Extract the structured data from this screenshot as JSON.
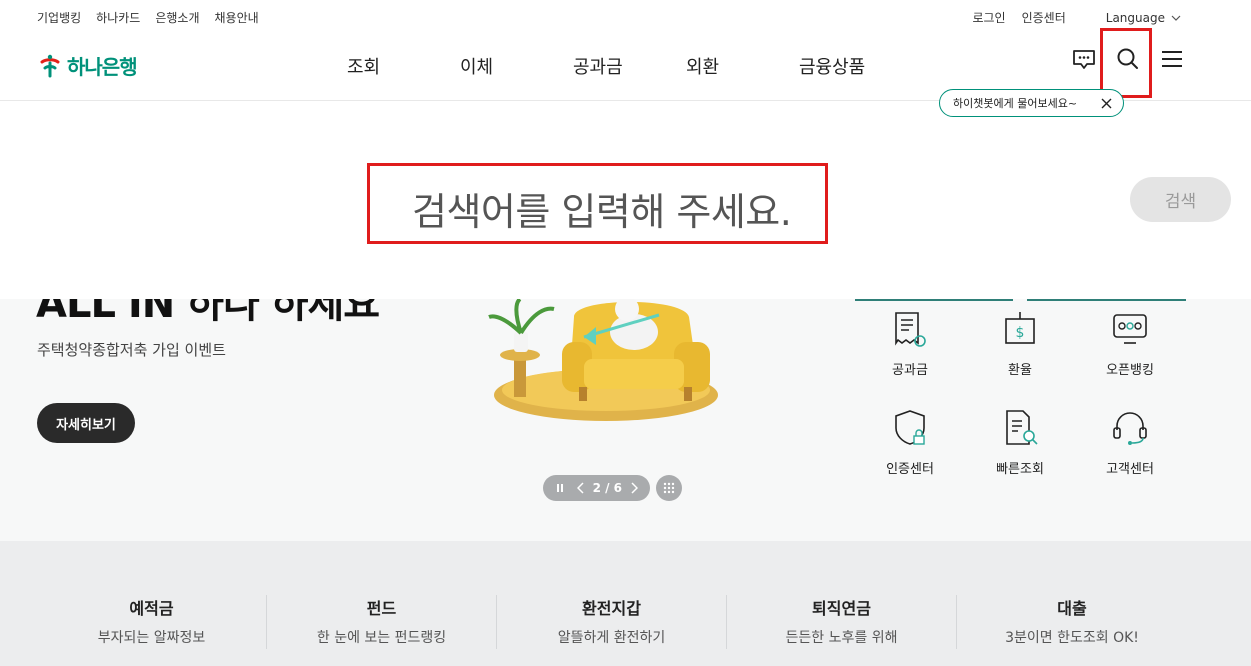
{
  "util": {
    "left": [
      "기업뱅킹",
      "하나카드",
      "은행소개",
      "채용안내"
    ],
    "login": "로그인",
    "cert_center": "인증센터",
    "language": "Language"
  },
  "logo": {
    "text": "하나은행"
  },
  "menu": [
    "조회",
    "이체",
    "공과금",
    "외환",
    "금융상품"
  ],
  "chatbot": {
    "bubble": "하이챗봇에게 물어보세요~"
  },
  "search": {
    "placeholder": "검색어를 입력해 주세요.",
    "button": "검색"
  },
  "hero": {
    "title": "ALL IN  하나  하세요",
    "subtitle": "주택청약종합저축 가입 이벤트",
    "cta": "자세히보기",
    "pager": "2 / 6"
  },
  "quick_menu": [
    "공과금",
    "환율",
    "오픈뱅킹",
    "인증센터",
    "빠른조회",
    "고객센터"
  ],
  "bottom_cards": [
    {
      "title": "예적금",
      "sub": "부자되는 알짜정보"
    },
    {
      "title": "펀드",
      "sub": "한 눈에 보는 펀드랭킹"
    },
    {
      "title": "환전지갑",
      "sub": "알뜰하게 환전하기"
    },
    {
      "title": "퇴직연금",
      "sub": "든든한 노후를 위해"
    },
    {
      "title": "대출",
      "sub": "3분이면 한도조회 OK!"
    }
  ],
  "colors": {
    "brand": "#00917a",
    "highlight": "#e01c1c"
  }
}
